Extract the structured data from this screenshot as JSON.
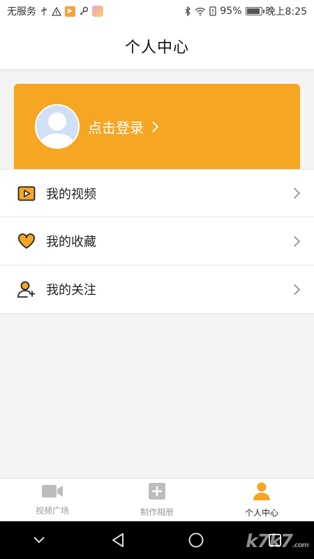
{
  "status_bar": {
    "carrier": "无服务",
    "battery_percent": "95%",
    "battery_level": 0.95,
    "time": "晚上8:25"
  },
  "header": {
    "title": "个人中心"
  },
  "profile": {
    "login_label": "点击登录"
  },
  "menu": {
    "items": [
      {
        "label": "我的视频",
        "icon": "video-play-icon"
      },
      {
        "label": "我的收藏",
        "icon": "heart-icon"
      },
      {
        "label": "我的关注",
        "icon": "user-add-icon"
      }
    ]
  },
  "tabs": [
    {
      "label": "视频广场",
      "icon": "video-camera-icon",
      "active": false
    },
    {
      "label": "制作相册",
      "icon": "plus-square-icon",
      "active": false
    },
    {
      "label": "个人中心",
      "icon": "person-icon",
      "active": true
    }
  ],
  "watermark": {
    "main": "k7k7",
    "suffix": ".com"
  },
  "colors": {
    "accent": "#f5a623",
    "inactive_tab": "#bbbbbb"
  }
}
